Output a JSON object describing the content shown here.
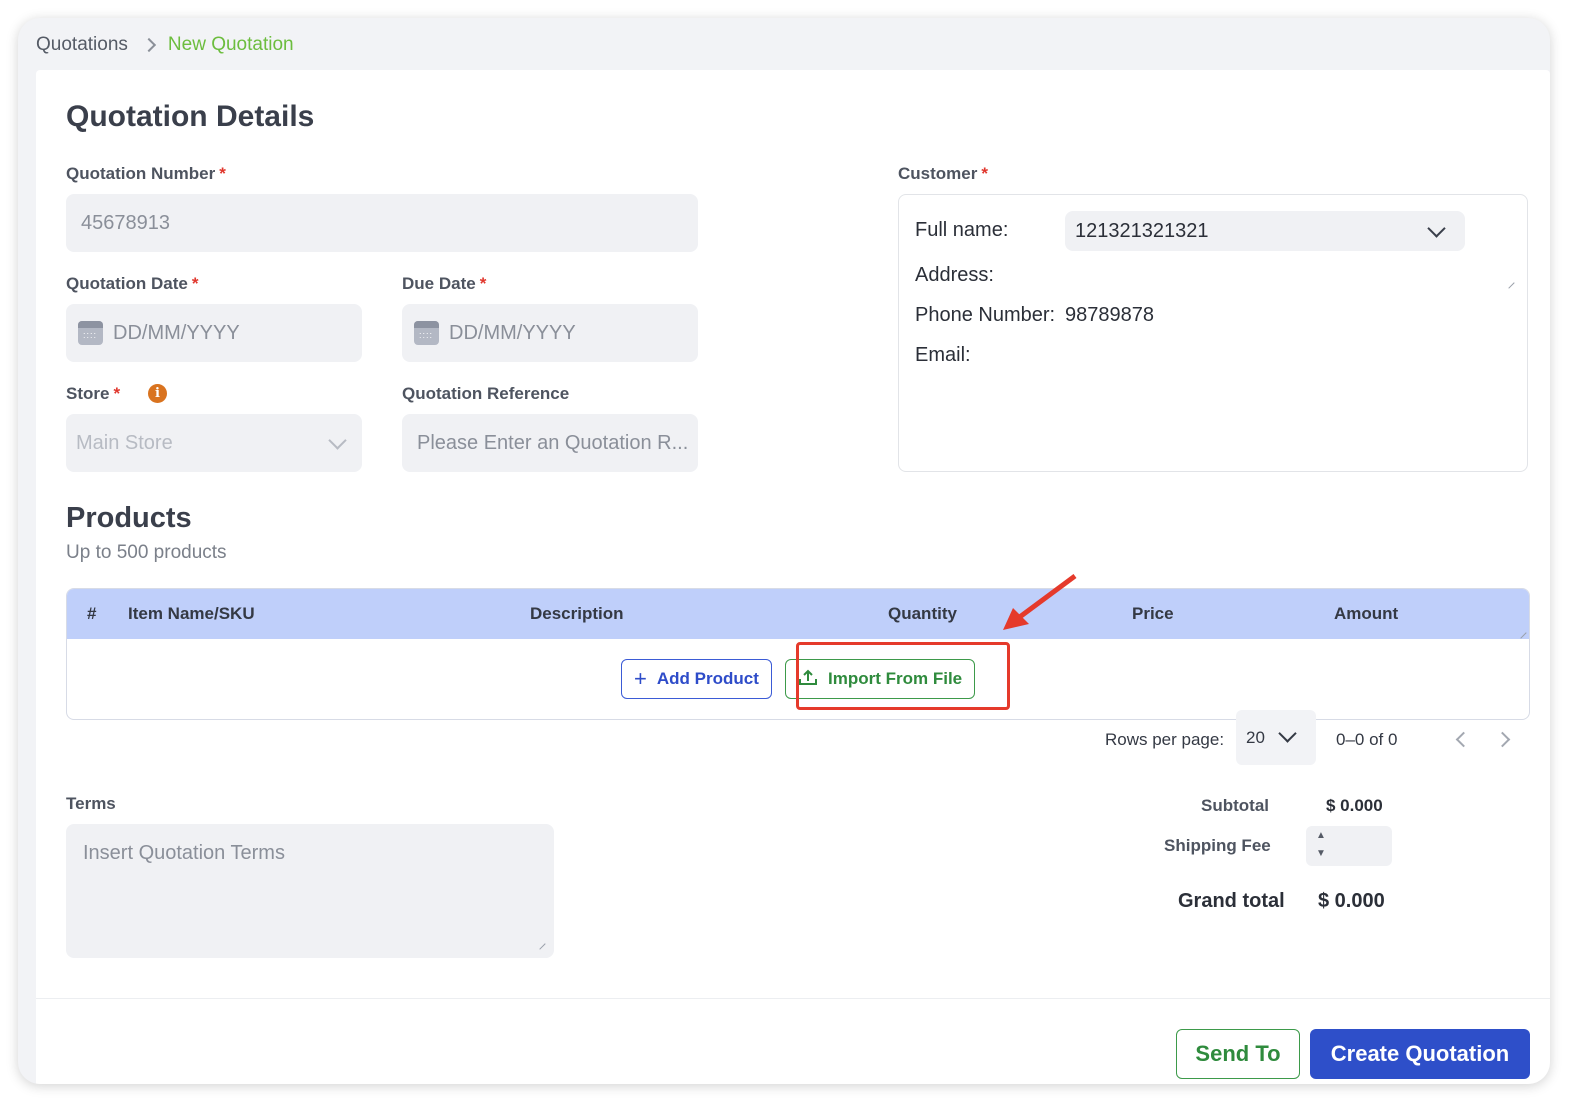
{
  "breadcrumb": {
    "root": "Quotations",
    "current": "New Quotation"
  },
  "details": {
    "title": "Quotation Details",
    "quotation_number": {
      "label": "Quotation Number",
      "value": "45678913"
    },
    "quotation_date": {
      "label": "Quotation Date",
      "placeholder": "DD/MM/YYYY"
    },
    "due_date": {
      "label": "Due Date",
      "placeholder": "DD/MM/YYYY"
    },
    "store": {
      "label": "Store",
      "value": "Main Store"
    },
    "reference": {
      "label": "Quotation Reference",
      "placeholder": "Please Enter an Quotation R..."
    },
    "required_mark": "*"
  },
  "customer": {
    "label": "Customer",
    "full_name_label": "Full name:",
    "full_name_value": "121321321321",
    "address_label": "Address:",
    "phone_label": "Phone Number:",
    "phone_value": "98789878",
    "email_label": "Email:"
  },
  "products": {
    "title": "Products",
    "subtitle": "Up to 500 products",
    "columns": [
      "#",
      "Item Name/SKU",
      "Description",
      "Quantity",
      "Price",
      "Amount"
    ],
    "add_label": "Add Product",
    "import_label": "Import From File"
  },
  "pagination": {
    "rows_label": "Rows per page:",
    "rows_value": "20",
    "range": "0–0 of 0"
  },
  "terms": {
    "label": "Terms",
    "placeholder": "Insert Quotation Terms"
  },
  "totals": {
    "subtotal_label": "Subtotal",
    "subtotal_value": "$ 0.000",
    "shipping_label": "Shipping Fee",
    "grand_label": "Grand total",
    "grand_value": "$ 0.000"
  },
  "actions": {
    "send": "Send To",
    "create": "Create Quotation"
  },
  "colors": {
    "accent": "#2e4fc9",
    "success": "#2f8b3d",
    "highlight": "#e53a2b",
    "table_header": "#bfcffa"
  }
}
